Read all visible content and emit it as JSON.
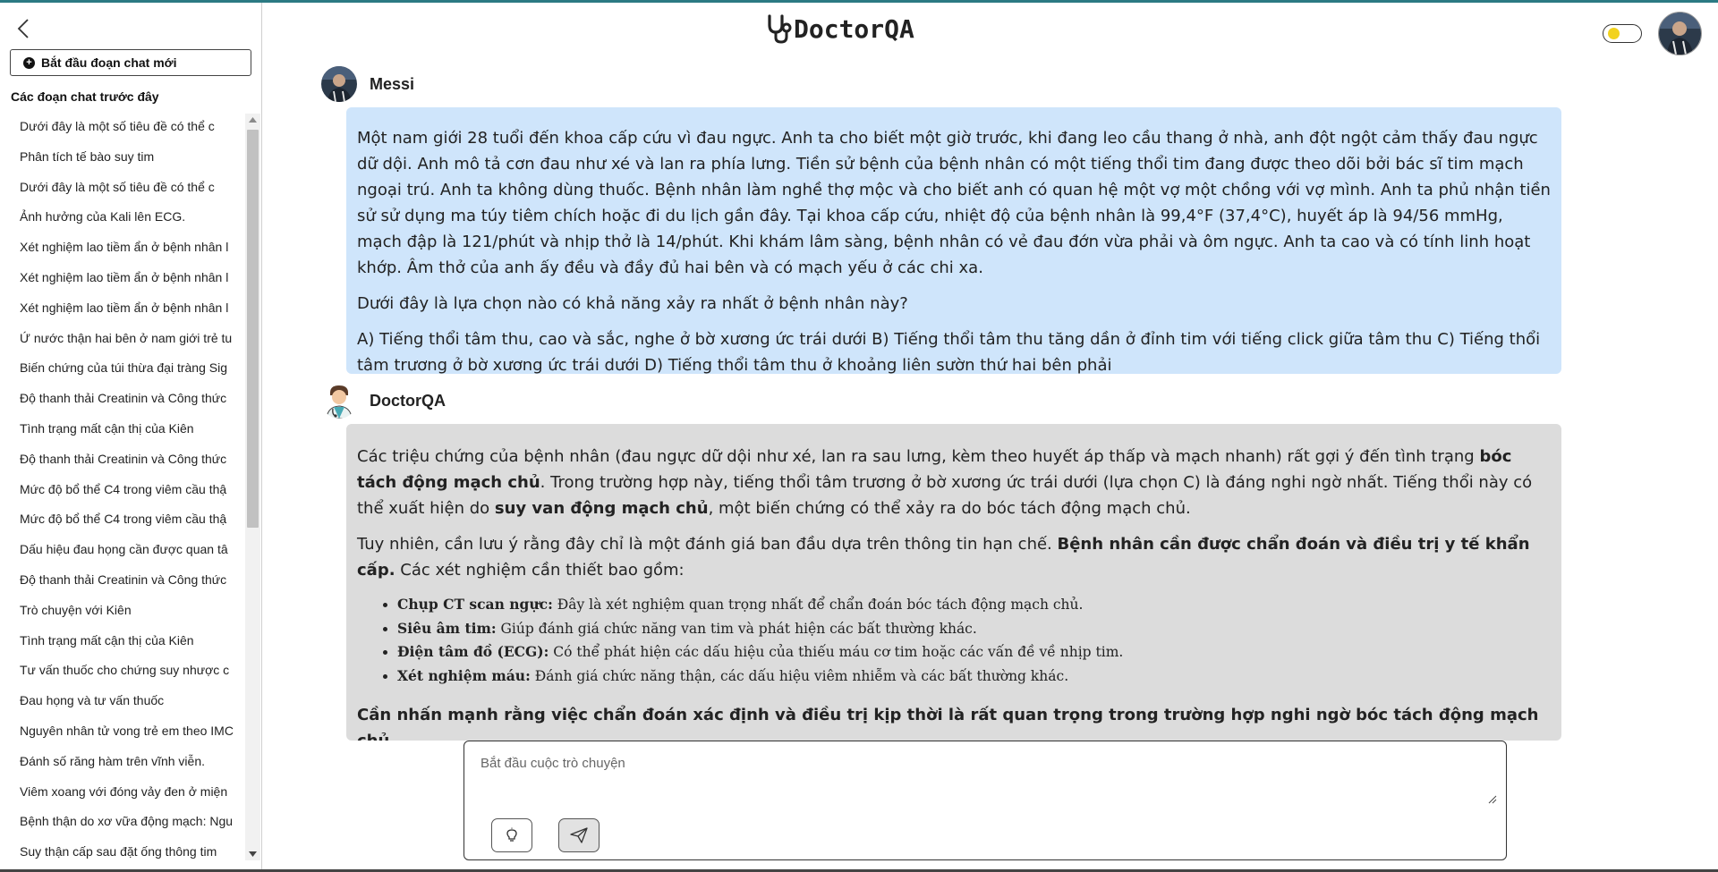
{
  "app": {
    "name": "DoctorQA"
  },
  "sidebar": {
    "new_chat_label": "Bắt đầu đoạn chat mới",
    "previous_title": "Các đoạn chat trước đây",
    "items": [
      "Dưới đây là một số tiêu đề có thể c",
      "Phân tích tế bào suy tim",
      "Dưới đây là một số tiêu đề có thể c",
      "Ảnh hưởng của Kali lên ECG.",
      "Xét nghiệm lao tiềm ẩn ở bệnh nhân l",
      "Xét nghiệm lao tiềm ẩn ở bệnh nhân l",
      "Xét nghiệm lao tiềm ẩn ở bệnh nhân l",
      "Ứ nước thận hai bên ở nam giới trẻ tu",
      "Biến chứng của túi thừa đại tràng Sig",
      "Độ thanh thải Creatinin và Công thức",
      "Tình trạng mất cận thị của Kiên",
      "Độ thanh thải Creatinin và Công thức",
      "Mức độ bổ thể C4 trong viêm cầu thậ",
      "Mức độ bổ thể C4 trong viêm cầu thậ",
      "Dấu hiệu đau họng cần được quan tâ",
      "Độ thanh thải Creatinin và Công thức",
      "Trò chuyện với Kiên",
      "Tình trạng mất cận thị của Kiên",
      "Tư vấn thuốc cho chứng suy nhược c",
      "Đau họng và tư vấn thuốc",
      "Nguyên nhân tử vong trẻ em theo IMC",
      "Đánh số răng hàm trên vĩnh viễn.",
      "Viêm xoang với đóng vảy đen ở miện",
      "Bệnh thận do xơ vữa động mạch: Ngu",
      "Suy thận cấp sau đặt ống thông tim"
    ]
  },
  "header": {
    "theme_toggle": "light"
  },
  "conversation": {
    "user": {
      "name": "Messi",
      "p1": "Một nam giới 28 tuổi đến khoa cấp cứu vì đau ngực. Anh ta cho biết một giờ trước, khi đang leo cầu thang ở nhà, anh đột ngột cảm thấy đau ngực dữ dội. Anh mô tả cơn đau như xé và lan ra phía lưng. Tiền sử bệnh của bệnh nhân có một tiếng thổi tim đang được theo dõi bởi bác sĩ tim mạch ngoại trú. Anh ta không dùng thuốc. Bệnh nhân làm nghề thợ mộc và cho biết anh có quan hệ một vợ một chồng với vợ mình. Anh ta phủ nhận tiền sử sử dụng ma túy tiêm chích hoặc đi du lịch gần đây. Tại khoa cấp cứu, nhiệt độ của bệnh nhân là 99,4°F (37,4°C), huyết áp là 94/56 mmHg, mạch đập là 121/phút và nhịp thở là 14/phút. Khi khám lâm sàng, bệnh nhân có vẻ đau đớn vừa phải và ôm ngực. Anh ta cao và có tính linh hoạt khớp. Âm thở của anh ấy đều và đầy đủ hai bên và có mạch yếu ở các chi xa.",
      "p2": "Dưới đây là lựa chọn nào có khả năng xảy ra nhất ở bệnh nhân này?",
      "p3": "A) Tiếng thổi tâm thu, cao và sắc, nghe ở bờ xương ức trái dưới B) Tiếng thổi tâm thu tăng dần ở đỉnh tim với tiếng click giữa tâm thu C) Tiếng thổi tâm trương ở bờ xương ức trái dưới D) Tiếng thổi tâm thu ở khoảng liên sườn thứ hai bên phải"
    },
    "bot": {
      "name": "DoctorQA",
      "p1_a": "Các triệu chứng của bệnh nhân (đau ngực dữ dội như xé, lan ra sau lưng, kèm theo huyết áp thấp và mạch nhanh) rất gợi ý đến tình trạng ",
      "p1_b": "bóc tách động mạch chủ",
      "p1_c": ". Trong trường hợp này, tiếng thổi tâm trương ở bờ xương ức trái dưới (lựa chọn C) là đáng nghi ngờ nhất. Tiếng thổi này có thể xuất hiện do ",
      "p1_d": "suy van động mạch chủ",
      "p1_e": ", một biến chứng có thể xảy ra do bóc tách động mạch chủ.",
      "p2_a": "Tuy nhiên, cần lưu ý rằng đây chỉ là một đánh giá ban đầu dựa trên thông tin hạn chế. ",
      "p2_b": "Bệnh nhân cần được chẩn đoán và điều trị y tế khẩn cấp.",
      "p2_c": " Các xét nghiệm cần thiết bao gồm:",
      "tests": [
        {
          "name": "Chụp CT scan ngực:",
          "desc": " Đây là xét nghiệm quan trọng nhất để chẩn đoán bóc tách động mạch chủ."
        },
        {
          "name": "Siêu âm tim:",
          "desc": " Giúp đánh giá chức năng van tim và phát hiện các bất thường khác."
        },
        {
          "name": "Điện tâm đồ (ECG):",
          "desc": " Có thể phát hiện các dấu hiệu của thiếu máu cơ tim hoặc các vấn đề về nhịp tim."
        },
        {
          "name": "Xét nghiệm máu:",
          "desc": " Đánh giá chức năng thận, các dấu hiệu viêm nhiễm và các bất thường khác."
        }
      ],
      "final": "Cần nhấn mạnh rằng việc chẩn đoán xác định và điều trị kịp thời là rất quan trọng trong trường hợp nghi ngờ bóc tách động mạch chủ."
    }
  },
  "composer": {
    "placeholder": "Bắt đầu cuộc trò chuyện"
  },
  "colors": {
    "user_bubble": "#cfe5fb",
    "bot_bubble": "#dcdcdc",
    "accent_top": "#2b7a83",
    "toggle_knob": "#f2d21d"
  }
}
